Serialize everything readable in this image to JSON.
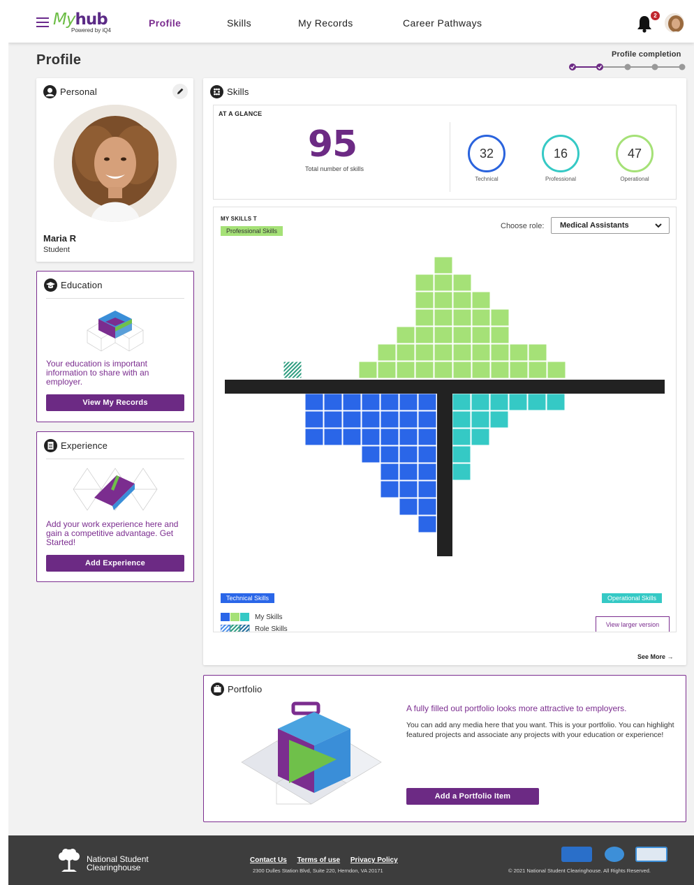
{
  "nav": {
    "logo_text": "hub",
    "logo_prefix": "My",
    "logo_sub": "Powered by iQ4",
    "links": [
      "Profile",
      "Skills",
      "My Records",
      "Career Pathways"
    ],
    "notifications": "2"
  },
  "header": {
    "title": "Profile",
    "completion_label": "Profile completion",
    "completion_steps_done": 2,
    "completion_steps_total": 5
  },
  "personal": {
    "title": "Personal",
    "name": "Maria R",
    "role": "Student"
  },
  "education": {
    "title": "Education",
    "text": "Your education is important information to share with an employer.",
    "button": "View My Records"
  },
  "experience": {
    "title": "Experience",
    "text": "Add your work experience here and gain a competitive advantage. Get Started!",
    "button": "Add Experience"
  },
  "skills": {
    "title": "Skills",
    "glance_label": "AT A GLANCE",
    "total": "95",
    "total_label": "Total number of skills",
    "technical": "32",
    "technical_label": "Technical",
    "professional": "16",
    "professional_label": "Professional",
    "operational": "47",
    "operational_label": "Operational",
    "my_skills_label": "MY SKILLS T",
    "professional_tag": "Professional Skills",
    "technical_tag": "Technical Skills",
    "operational_tag": "Operational Skills",
    "choose_role_label": "Choose role:",
    "role_value": "Medical Assistants",
    "legend_my": "My Skills",
    "legend_role": "Role Skills",
    "view_larger": "View larger version",
    "see_more": "See More"
  },
  "portfolio": {
    "title": "Portfolio",
    "headline": "A fully filled out portfolio looks more attractive to employers.",
    "body": "You can add any media here that you want. This is your portfolio. You can highlight featured projects and associate any projects with your education or experience!",
    "button": "Add a Portfolio Item"
  },
  "footer": {
    "org_line1": "National Student",
    "org_line2": "Clearinghouse",
    "contact": "Contact Us",
    "terms": "Terms of use",
    "privacy": "Privacy Policy",
    "address": "2300 Dulles Station Blvd, Suite 220, Herndon, VA 20171",
    "copyright": "© 2021 National Student Clearinghouse. All Rights Reserved."
  },
  "colors": {
    "brand_purple": "#6c2a84",
    "professional_green": "#a5e177",
    "technical_blue": "#2a66e8",
    "operational_teal": "#35c9c5"
  },
  "skill_grid": {
    "professional_columns": [
      1,
      0,
      0,
      0,
      1,
      2,
      3,
      6,
      7,
      6,
      5,
      4,
      2,
      2,
      1,
      0,
      0,
      0
    ],
    "technical_columns": [
      3,
      3,
      3,
      4,
      6,
      7,
      8
    ],
    "operational_columns": [
      5,
      3,
      2,
      1,
      1,
      1
    ],
    "note_role_cells": "striped"
  }
}
